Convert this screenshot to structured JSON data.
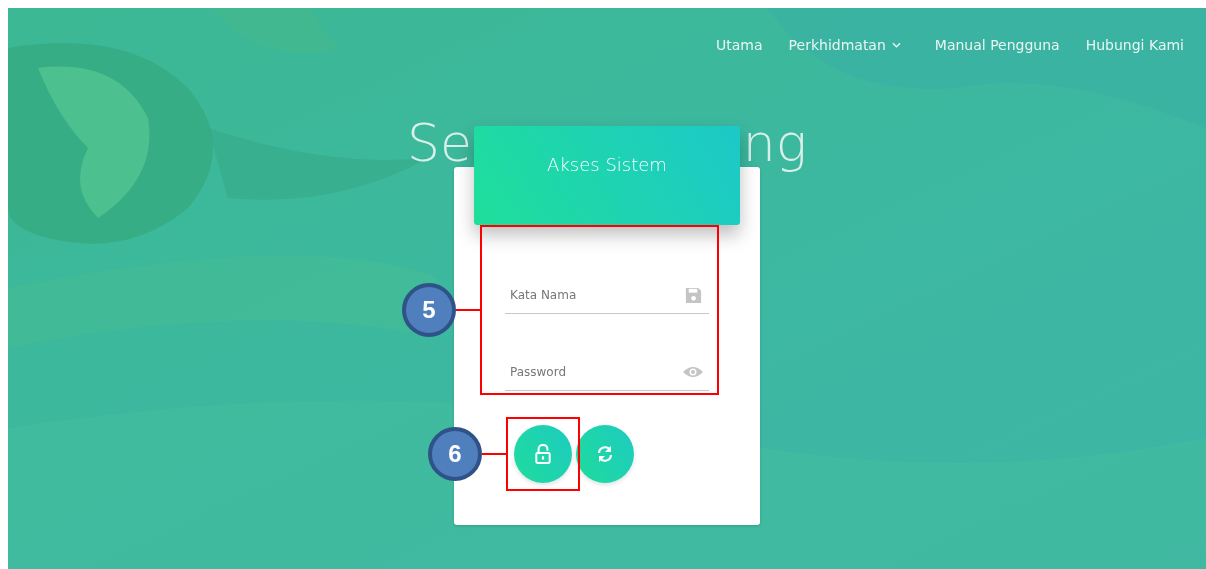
{
  "nav": {
    "items": [
      {
        "label": "Utama",
        "dropdown": false
      },
      {
        "label": "Perkhidmatan",
        "dropdown": true
      },
      {
        "label": "Manual Pengguna",
        "dropdown": false
      },
      {
        "label": "Hubungi Kami",
        "dropdown": false
      }
    ]
  },
  "heading": {
    "left": "Se",
    "right": "ng"
  },
  "login_card": {
    "title": "Akses Sistem",
    "fields_callout": "5",
    "fields": [
      {
        "kind": "text",
        "placeholder": "Kata Nama"
      },
      {
        "kind": "password",
        "placeholder": "Password"
      }
    ],
    "buttons": [
      {
        "kind": "login",
        "callout": "6"
      },
      {
        "kind": "reset"
      }
    ]
  }
}
